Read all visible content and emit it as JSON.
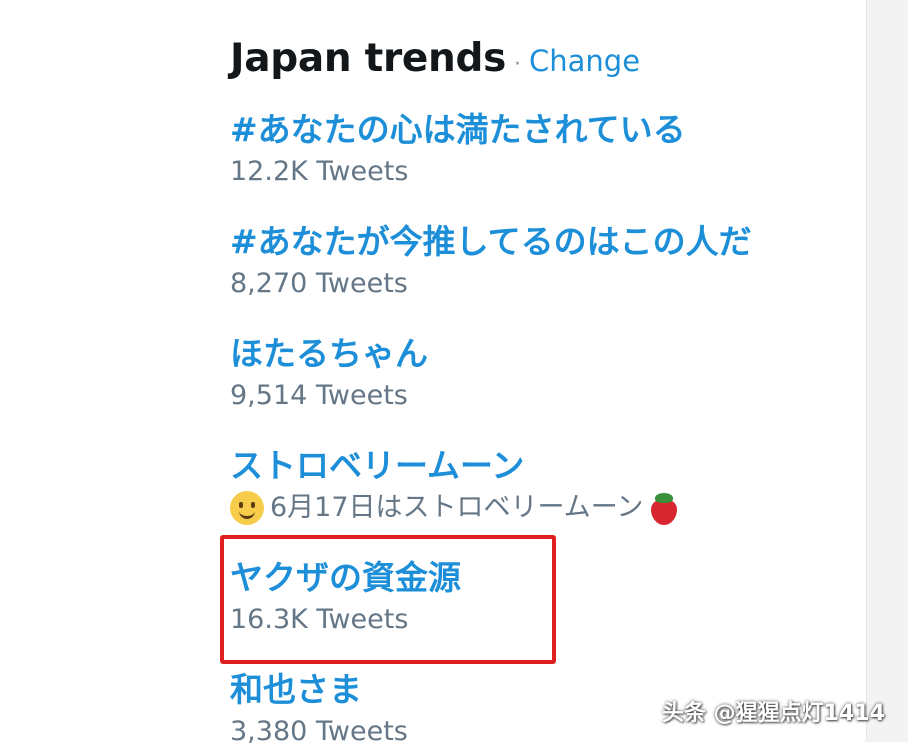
{
  "header": {
    "title": "Japan trends",
    "separator": "·",
    "change_label": "Change"
  },
  "trends": [
    {
      "name": "#あなたの心は満たされている",
      "meta": "12.2K Tweets"
    },
    {
      "name": "#あなたが今推してるのはこの人だ",
      "meta": "8,270 Tweets"
    },
    {
      "name": "ほたるちゃん",
      "meta": "9,514 Tweets"
    },
    {
      "name": "ストロベリームーン",
      "meta": "6月17日はストロベリームーン",
      "meta_icons": [
        "smiling-face-icon",
        "strawberry-icon"
      ]
    },
    {
      "name": "ヤクザの資金源",
      "meta": "16.3K Tweets",
      "highlighted": true
    },
    {
      "name": "和也さま",
      "meta": "3,380 Tweets"
    }
  ],
  "annotation": {
    "highlight_color": "#e02020"
  },
  "colors": {
    "link": "#1d8fd8",
    "meta": "#657786",
    "title": "#14171a"
  },
  "watermark": {
    "text": "头条 @猩猩点灯1414"
  }
}
